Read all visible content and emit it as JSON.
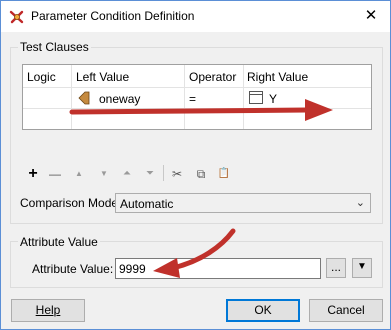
{
  "window": {
    "title": "Parameter Condition Definition",
    "close_glyph": "✕"
  },
  "test_clauses": {
    "group_label": "Test Clauses",
    "columns": [
      "Logic",
      "Left Value",
      "Operator",
      "Right Value"
    ],
    "rows": [
      {
        "logic": "",
        "left_value": "oneway",
        "operator": "=",
        "right_value": "Y"
      }
    ]
  },
  "toolbar": {
    "add_glyph": "+",
    "remove_glyph": "—",
    "move_up_glyph": "▲",
    "move_down_glyph": "▼",
    "move_top_glyph": "⏶",
    "move_bottom_glyph": "⏷",
    "cut_glyph": "✂",
    "copy_glyph": "⧉",
    "paste_glyph": "📋"
  },
  "comparison_mode": {
    "label": "Comparison Mode:",
    "value": "Automatic",
    "arrow": "⌄"
  },
  "attribute_value_group": {
    "group_label": "Attribute Value",
    "field_label": "Attribute Value:",
    "value": "9999",
    "ellipsis_label": "...",
    "dropdown_glyph": "▼"
  },
  "buttons": {
    "help": "Help",
    "ok": "OK",
    "cancel": "Cancel"
  },
  "colors": {
    "arrow": "#c0312b",
    "accent": "#0078d7",
    "attr_icon": "#c58a3f"
  }
}
